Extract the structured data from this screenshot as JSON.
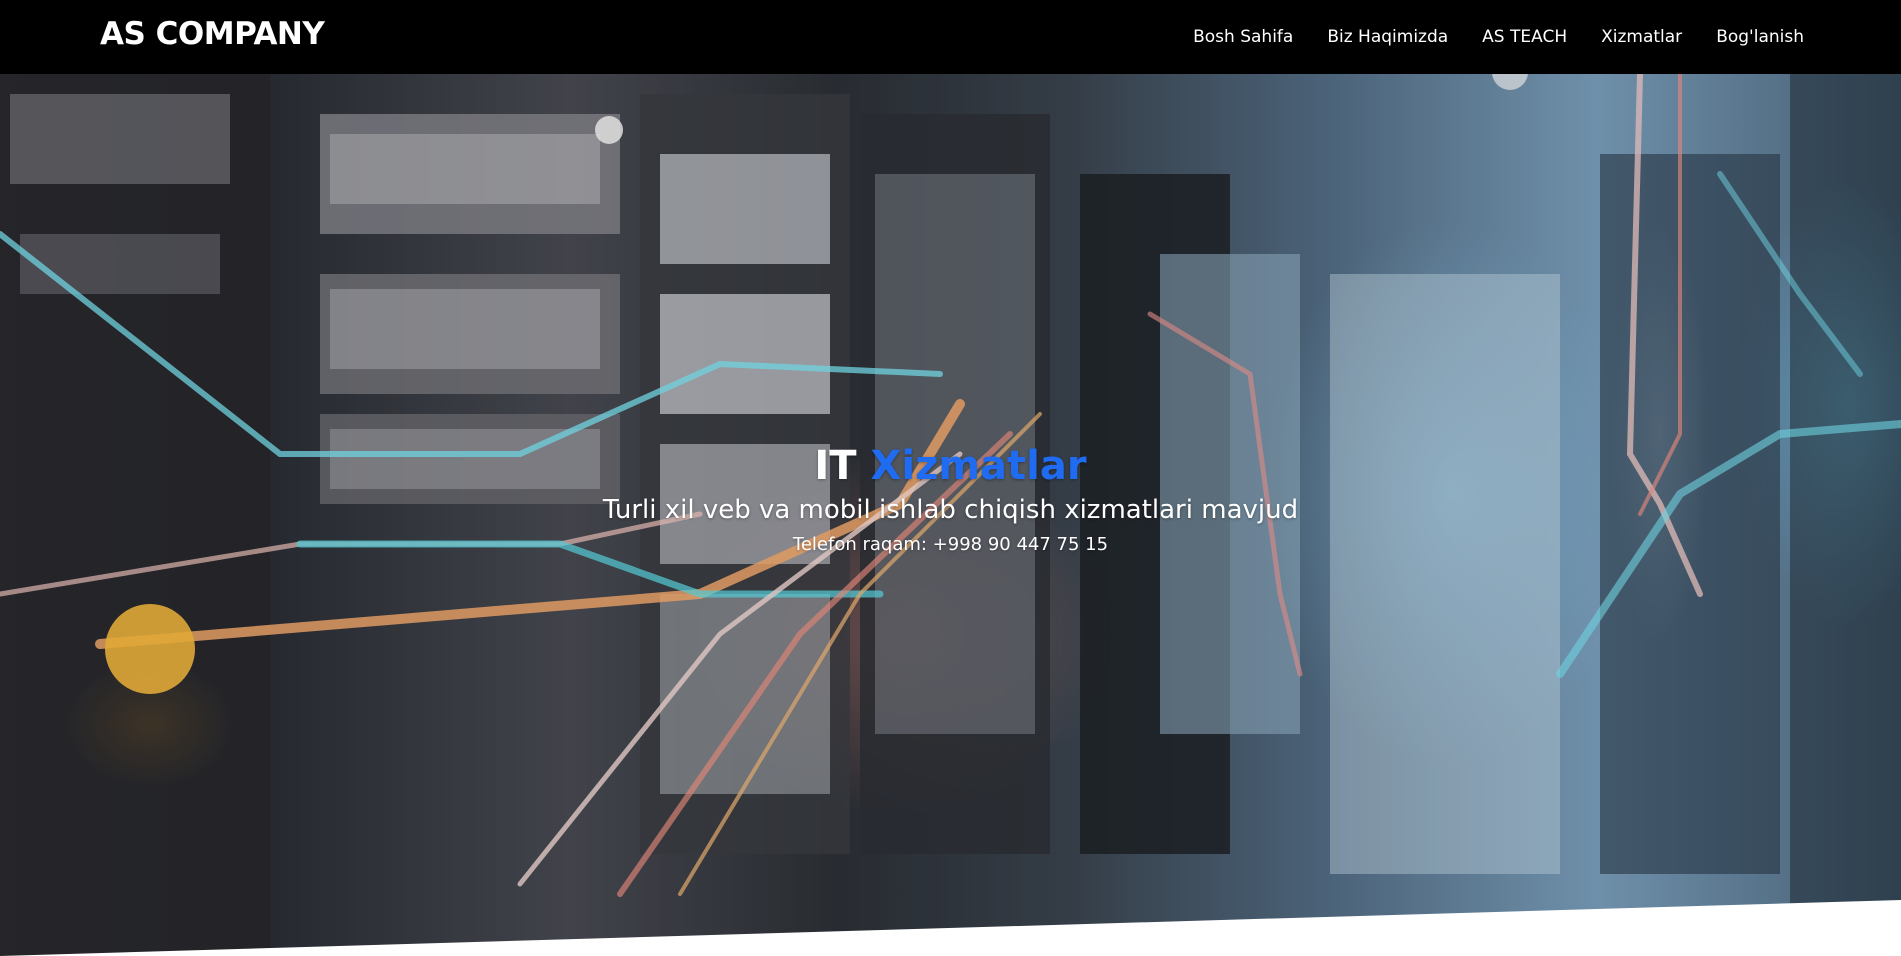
{
  "navbar": {
    "brand": "AS COMPANY",
    "links": [
      {
        "label": "Bosh Sahifa"
      },
      {
        "label": "Biz Haqimizda"
      },
      {
        "label": "AS TEACH"
      },
      {
        "label": "Xizmatlar"
      },
      {
        "label": "Bog'lanish"
      }
    ]
  },
  "hero": {
    "title_prefix": "IT",
    "title_accent": "Xizmatlar",
    "subtitle": "Turli xil veb va mobil ishlab chiqish xizmatlari mavjud",
    "phone": "Telefon raqam: +998 90 447 75 15",
    "background": "server-room-photo"
  },
  "colors": {
    "navbar_bg": "#000000",
    "accent": "#1f6cf2",
    "text": "#ffffff"
  }
}
